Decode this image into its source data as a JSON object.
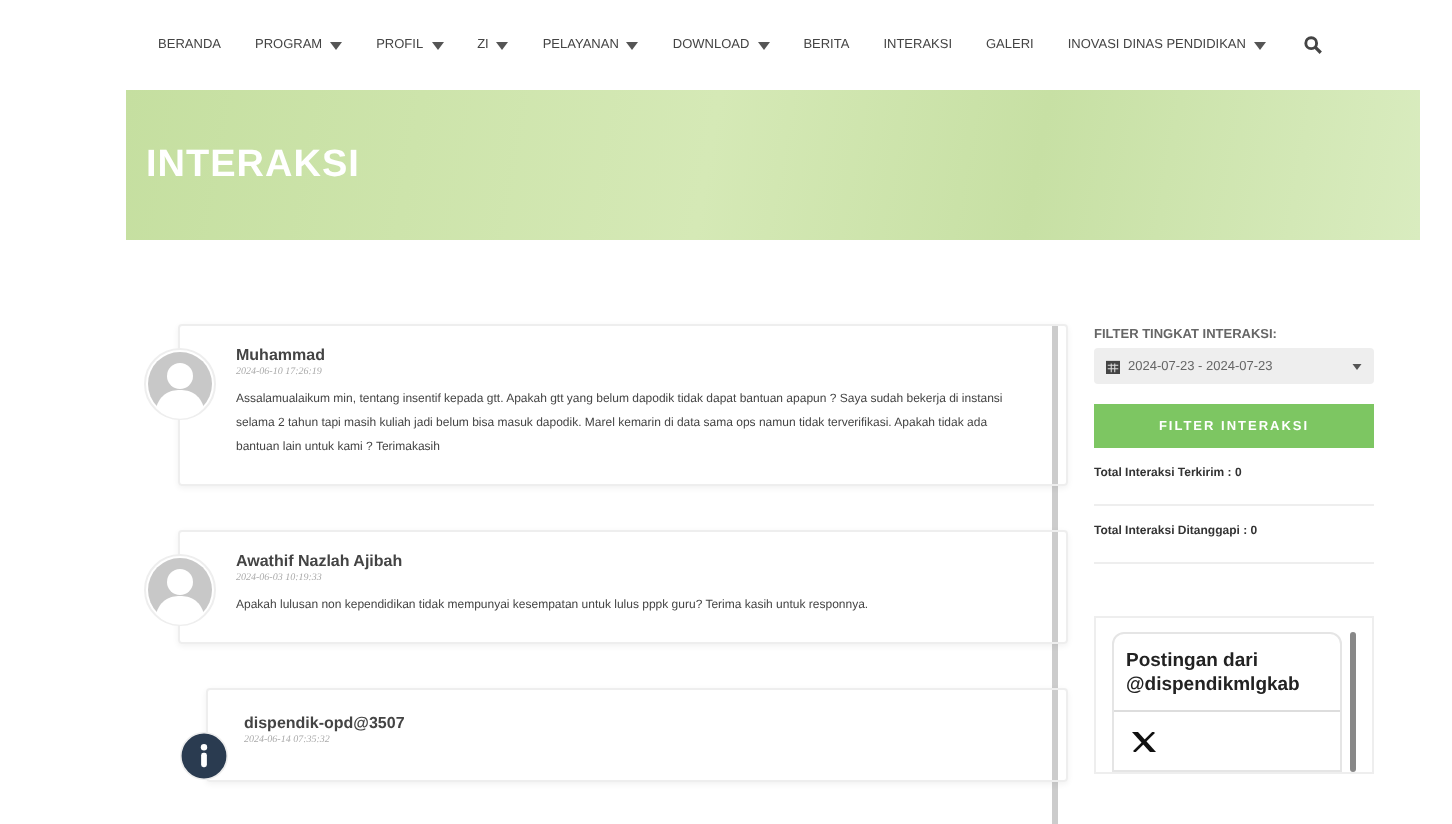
{
  "nav": [
    {
      "label": "BERANDA",
      "dropdown": false
    },
    {
      "label": "PROGRAM",
      "dropdown": true
    },
    {
      "label": "PROFIL",
      "dropdown": true
    },
    {
      "label": "ZI",
      "dropdown": true
    },
    {
      "label": "PELAYANAN",
      "dropdown": true
    },
    {
      "label": "DOWNLOAD",
      "dropdown": true
    },
    {
      "label": "BERITA",
      "dropdown": false
    },
    {
      "label": "INTERAKSI",
      "dropdown": false
    },
    {
      "label": "GALERI",
      "dropdown": false
    },
    {
      "label": "INOVASI DINAS PENDIDIKAN",
      "dropdown": true
    }
  ],
  "banner": {
    "title": "INTERAKSI"
  },
  "comments": [
    {
      "kind": "user",
      "name": "Muhammad",
      "date": "2024-06-10 17:26:19",
      "text": "Assalamualaikum min, tentang insentif kepada gtt. Apakah gtt yang belum dapodik tidak dapat bantuan apapun ? Saya sudah bekerja di instansi selama 2 tahun tapi masih kuliah jadi belum bisa masuk dapodik. Marel kemarin di data sama ops namun tidak terverifikasi. Apakah tidak ada bantuan lain untuk kami ? Terimakasih"
    },
    {
      "kind": "user",
      "name": "Awathif Nazlah Ajibah",
      "date": "2024-06-03 10:19:33",
      "text": "Apakah lulusan non kependidikan tidak mempunyai kesempatan untuk lulus pppk guru? Terima kasih untuk responnya."
    },
    {
      "kind": "admin",
      "name": "dispendik-opd@3507",
      "date": "2024-06-14 07:35:32"
    }
  ],
  "sidebar": {
    "filter_label": "FILTER TINGKAT INTERAKSI:",
    "date_range": "2024-07-23 - 2024-07-23",
    "filter_button": "FILTER INTERAKSI",
    "stats": [
      "Total Interaksi Terkirim : 0",
      "Total Interaksi Ditanggapi : 0"
    ],
    "embed_title": "Postingan dari @dispendikmlgkab"
  }
}
